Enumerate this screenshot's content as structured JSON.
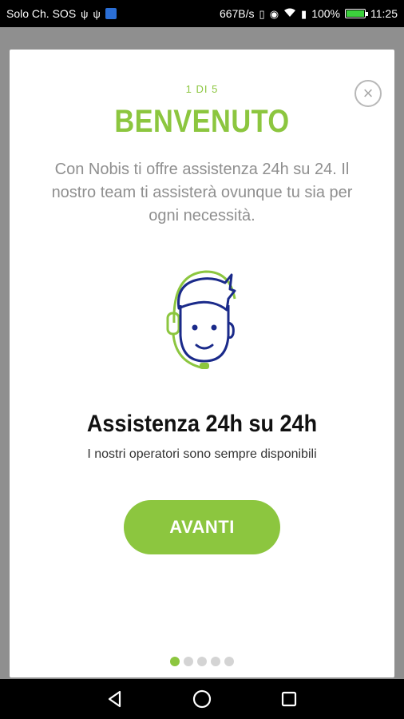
{
  "status_bar": {
    "carrier": "Solo Ch. SOS",
    "net_speed": "667B/s",
    "battery": "100%",
    "time": "11:25"
  },
  "modal": {
    "step": "1 DI 5",
    "title": "BENVENUTO",
    "intro": "Con Nobis ti offre assistenza 24h su 24. Il nostro team ti assisterà ovunque tu sia per ogni necessità.",
    "feature_title": "Assistenza 24h su 24h",
    "feature_text": "I nostri operatori sono sempre disponibili",
    "next_label": "AVANTI",
    "close_label": "×",
    "total_pages": 5,
    "current_page": 1
  },
  "colors": {
    "accent": "#8cc63f",
    "illustration_blue": "#1a2a8a"
  },
  "icons": [
    "usb-icon",
    "usb-icon",
    "app-notification-icon",
    "vibrate-icon",
    "eye-icon",
    "wifi-icon",
    "battery-icon",
    "close-icon",
    "operator-headset-icon",
    "back-icon",
    "home-icon",
    "recents-icon"
  ]
}
